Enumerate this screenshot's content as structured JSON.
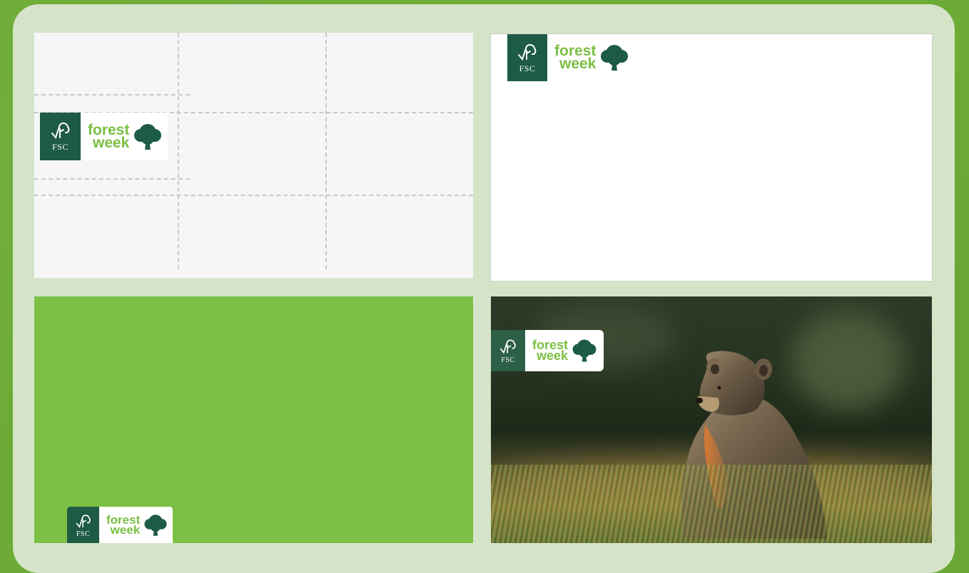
{
  "logo": {
    "fsc_label": "FSC",
    "registered": "®",
    "forest": "forest",
    "week": "week"
  },
  "panels": [
    {
      "name": "clearspace-guide",
      "background": "#f6f6f6"
    },
    {
      "name": "white-background",
      "background": "#ffffff"
    },
    {
      "name": "green-background",
      "background": "#7bbf44"
    },
    {
      "name": "photo-background",
      "subject": "brown bear in grass"
    }
  ],
  "colors": {
    "fsc_dark_green": "#1d5b45",
    "forest_week_green": "#7bbf44",
    "board": "#d5e4c9",
    "outer": "#6cab35"
  },
  "icons": [
    "fsc-checktree-icon",
    "oak-tree-icon"
  ]
}
